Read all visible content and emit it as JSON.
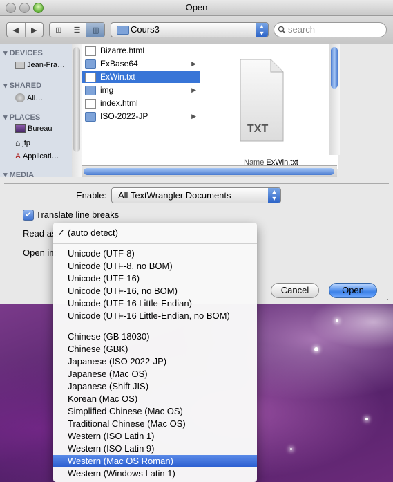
{
  "window": {
    "title": "Open"
  },
  "toolbar": {
    "back_icon": "chevron-left-icon",
    "forward_icon": "chevron-right-icon",
    "view_modes": [
      "icon-view",
      "list-view",
      "column-view"
    ],
    "path": "Cours3",
    "search_placeholder": "search"
  },
  "sidebar": {
    "devices_header": "DEVICES",
    "devices": [
      {
        "label": "Jean-Fra…",
        "icon": "computer-icon"
      }
    ],
    "shared_header": "SHARED",
    "shared": [
      {
        "label": "All…",
        "icon": "network-icon"
      }
    ],
    "places_header": "PLACES",
    "places": [
      {
        "label": "Bureau",
        "icon": "desktop-icon"
      },
      {
        "label": "jfp",
        "icon": "home-icon"
      },
      {
        "label": "Applicati…",
        "icon": "applications-icon"
      }
    ],
    "media_header": "MEDIA"
  },
  "files": [
    {
      "name": "Bizarre.html",
      "kind": "document",
      "folder": false
    },
    {
      "name": "ExBase64",
      "kind": "folder",
      "folder": true
    },
    {
      "name": "ExWin.txt",
      "kind": "document",
      "folder": false,
      "selected": true
    },
    {
      "name": "img",
      "kind": "folder",
      "folder": true
    },
    {
      "name": "index.html",
      "kind": "document",
      "folder": false
    },
    {
      "name": "ISO-2022-JP",
      "kind": "folder",
      "folder": true
    }
  ],
  "preview": {
    "badge": "TXT",
    "name_label": "Name",
    "name_value": "ExWin.txt"
  },
  "options": {
    "enable_label": "Enable:",
    "enable_value": "All TextWrangler Documents",
    "translate_label": "Translate line breaks",
    "translate_checked": true,
    "read_as_label": "Read as:",
    "open_in_label": "Open in:"
  },
  "buttons": {
    "cancel": "Cancel",
    "open": "Open"
  },
  "menu": {
    "group1": [
      "(auto detect)"
    ],
    "checked_item": "(auto detect)",
    "group2": [
      "Unicode (UTF-8)",
      "Unicode (UTF-8, no BOM)",
      "Unicode (UTF-16)",
      "Unicode (UTF-16, no BOM)",
      "Unicode (UTF-16 Little-Endian)",
      "Unicode (UTF-16 Little-Endian, no BOM)"
    ],
    "group3": [
      "Chinese (GB 18030)",
      "Chinese (GBK)",
      "Japanese (ISO 2022-JP)",
      "Japanese (Mac OS)",
      "Japanese (Shift JIS)",
      "Korean (Mac OS)",
      "Simplified Chinese (Mac OS)",
      "Traditional Chinese (Mac OS)",
      "Western (ISO Latin 1)",
      "Western (ISO Latin 9)",
      "Western (Mac OS Roman)",
      "Western (Windows Latin 1)"
    ],
    "highlighted_item": "Western (Mac OS Roman)"
  },
  "colors": {
    "selection": "#3875d7",
    "menu_highlight": "#2a5dd0",
    "desktop": "#5a2a6e"
  }
}
